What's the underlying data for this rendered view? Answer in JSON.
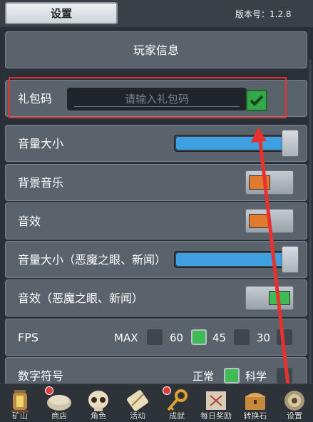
{
  "header": {
    "tab_label": "设置",
    "version": "版本号：1.2.8"
  },
  "settings": {
    "player_info": "玩家信息",
    "gift_code": {
      "label": "礼包码",
      "placeholder": "请输入礼包码"
    },
    "volume": {
      "label": "音量大小",
      "value": 1.0
    },
    "bgm": {
      "label": "背景音乐",
      "enabled": false
    },
    "sfx": {
      "label": "音效",
      "enabled": false
    },
    "volume_eye": {
      "label": "音量大小（恶魔之眼、新闻）",
      "value": 1.0
    },
    "sfx_eye": {
      "label": "音效（恶魔之眼、新闻）",
      "enabled": true
    },
    "fps": {
      "label": "FPS",
      "options": [
        "MAX",
        "60",
        "45",
        "30"
      ],
      "selected": "60"
    },
    "number_format": {
      "label": "数字符号",
      "options": [
        "正常",
        "科学"
      ],
      "selected": "正常"
    }
  },
  "nav": {
    "items": [
      {
        "label": "矿山",
        "icon": "lantern-icon",
        "badge": false
      },
      {
        "label": "商店",
        "icon": "stone-chest-icon",
        "badge": true
      },
      {
        "label": "角色",
        "icon": "skull-icon",
        "badge": false
      },
      {
        "label": "活动",
        "icon": "scroll-icon",
        "badge": false
      },
      {
        "label": "成就",
        "icon": "key-icon",
        "badge": true
      },
      {
        "label": "每日奖励",
        "icon": "map-icon",
        "badge": false
      },
      {
        "label": "转换石",
        "icon": "treasure-chest-icon",
        "badge": false
      },
      {
        "label": "设置",
        "icon": "gear-icon",
        "badge": false
      }
    ]
  },
  "colors": {
    "toggle_off": "#e07a2e",
    "toggle_on": "#3fbb55",
    "slider": "#3ea0e0",
    "annotation": "#e8312f"
  }
}
